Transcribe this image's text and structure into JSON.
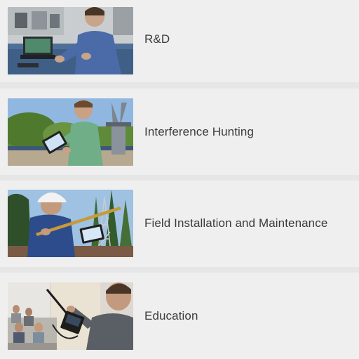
{
  "applications": [
    {
      "label": "R&D",
      "image_icon": "lab-technician-laptop-photo"
    },
    {
      "label": "Interference Hunting",
      "image_icon": "outdoor-tablet-antenna-photo"
    },
    {
      "label": "Field Installation and Maintenance",
      "image_icon": "hardhat-worker-tower-photo"
    },
    {
      "label": "Education",
      "image_icon": "classroom-instructor-photo"
    }
  ]
}
